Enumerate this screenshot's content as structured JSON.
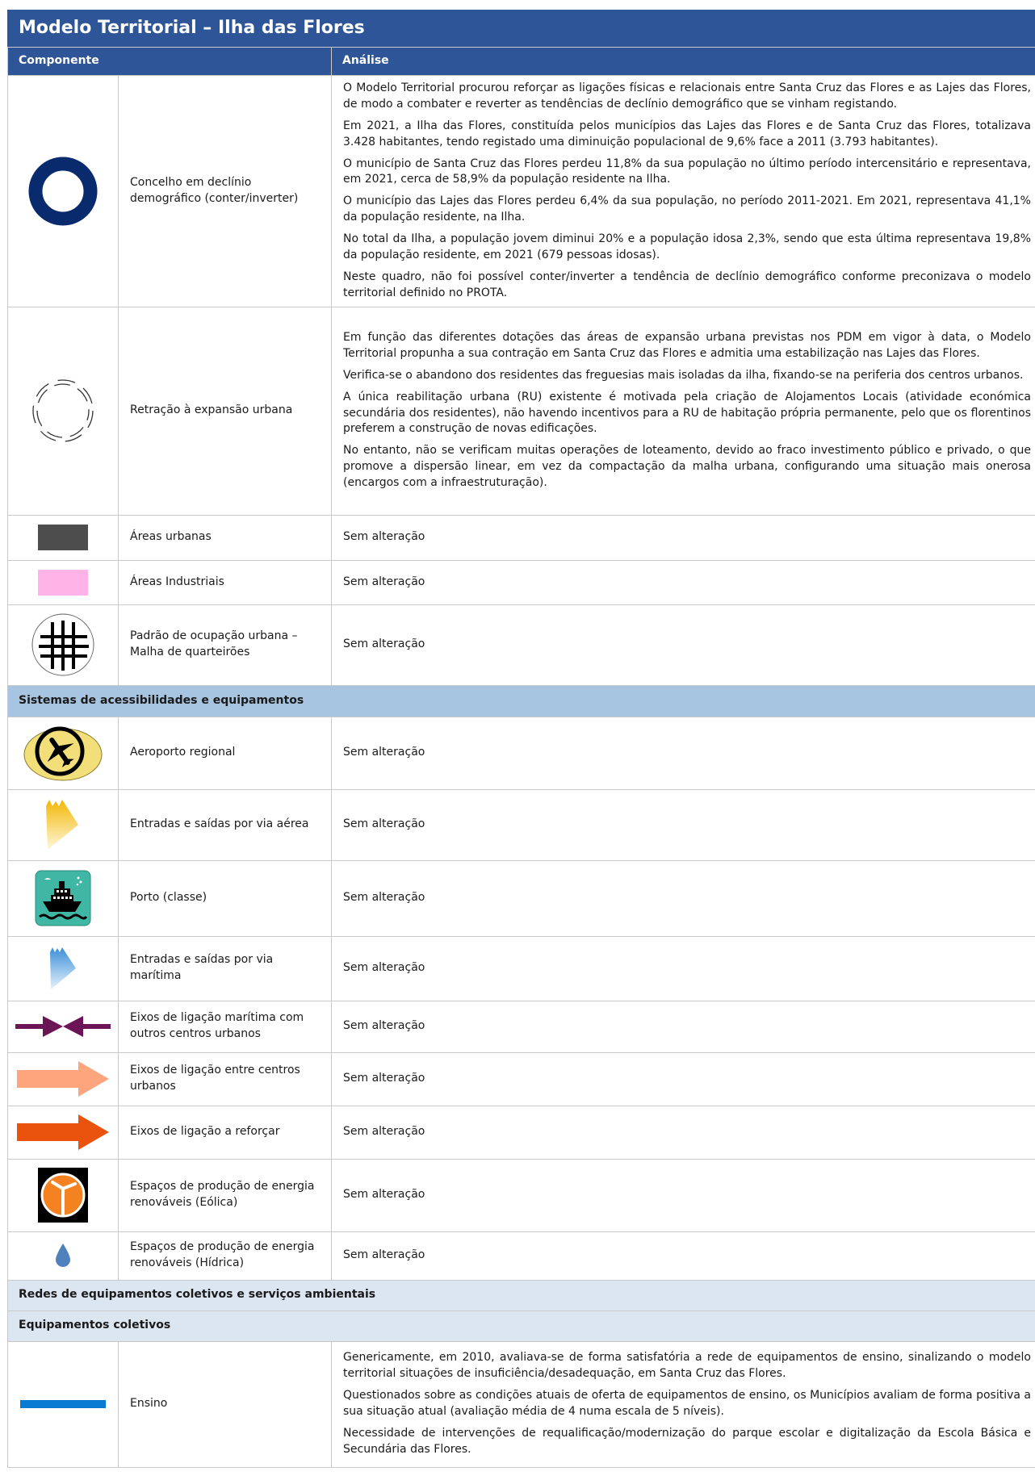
{
  "title": "Modelo Territorial – Ilha das Flores",
  "header": {
    "component": "Componente",
    "analysis": "Análise"
  },
  "rows": {
    "declinio": {
      "label": "Concelho em declínio demográfico (conter/inverter)",
      "paragraphs": [
        "O Modelo Territorial procurou reforçar as ligações físicas e relacionais entre Santa Cruz das Flores e as Lajes das Flores, de modo a combater e reverter as tendências de declínio demográfico que se vinham registando.",
        "Em 2021, a Ilha das Flores, constituída pelos municípios das Lajes das Flores e de Santa Cruz das Flores, totalizava 3.428 habitantes, tendo registado uma diminuição populacional de 9,6% face a 2011 (3.793 habitantes).",
        "O município de Santa Cruz das Flores perdeu 11,8% da sua população no último período intercensitário e representava, em 2021, cerca de 58,9% da população residente na Ilha.",
        "O município das Lajes das Flores perdeu 6,4% da sua população, no período 2011-2021. Em 2021, representava 41,1% da população residente, na Ilha.",
        "No total da Ilha, a população jovem diminui 20% e a população idosa 2,3%, sendo que esta última representava 19,8% da população residente, em 2021 (679 pessoas idosas).",
        "Neste quadro, não foi possível conter/inverter a tendência de declínio demográfico conforme preconizava o modelo territorial definido no PROTA."
      ]
    },
    "retracao": {
      "label": "Retração à expansão urbana",
      "paragraphs": [
        "Em função das diferentes dotações das áreas de expansão urbana previstas nos PDM em vigor à data, o Modelo Territorial propunha a sua contração em Santa Cruz das Flores e admitia uma estabilização nas Lajes das Flores.",
        "Verifica-se o abandono dos residentes das freguesias mais isoladas da ilha, fixando-se na periferia dos centros urbanos.",
        "A única reabilitação urbana (RU) existente é motivada pela criação de Alojamentos Locais (atividade económica secundária dos residentes), não havendo incentivos para a RU de habitação própria permanente, pelo que os florentinos preferem a construção de novas edificações.",
        "No entanto, não se verificam muitas operações de loteamento, devido ao fraco investimento público e privado, o que promove a dispersão linear, em vez da compactação da malha urbana, configurando uma situação mais onerosa (encargos com a infraestruturação)."
      ]
    },
    "areas_urbanas": {
      "label": "Áreas urbanas",
      "analysis": "Sem alteração"
    },
    "areas_industriais": {
      "label": "Áreas Industriais",
      "analysis": "Sem alteração"
    },
    "padrao": {
      "label": "Padrão de ocupação urbana – Malha de quarteirões",
      "analysis": "Sem alteração"
    },
    "aeroporto": {
      "label": "Aeroporto regional",
      "analysis": "Sem alteração"
    },
    "via_aerea": {
      "label": "Entradas e saídas por via aérea",
      "analysis": "Sem alteração"
    },
    "porto": {
      "label": "Porto (classe)",
      "analysis": "Sem alteração"
    },
    "via_maritima": {
      "label": "Entradas e saídas por via marítima",
      "analysis": "Sem alteração"
    },
    "eixos_maritimos": {
      "label": "Eixos de ligação marítima com outros centros urbanos",
      "analysis": "Sem alteração"
    },
    "eixos_centros": {
      "label": "Eixos de ligação entre centros urbanos",
      "analysis": "Sem alteração"
    },
    "eixos_reforcar": {
      "label": "Eixos de ligação a reforçar",
      "analysis": "Sem alteração"
    },
    "eolica": {
      "label": "Espaços de produção de energia renováveis (Eólica)",
      "analysis": "Sem alteração"
    },
    "hidrica": {
      "label": "Espaços de produção de energia renováveis (Hídrica)",
      "analysis": "Sem alteração"
    },
    "ensino": {
      "label": "Ensino",
      "paragraphs": [
        "Genericamente, em 2010, avaliava-se de forma satisfatória a rede de equipamentos de ensino, sinalizando o modelo territorial situações de insuficiência/desadequação, em Santa Cruz das Flores.",
        "Questionados sobre as condições atuais de oferta de equipamentos de ensino, os Municípios avaliam de forma positiva a sua situação atual (avaliação média de 4 numa escala de 5 níveis).",
        "Necessidade de intervenções de requalificação/modernização do parque escolar e digitalização da Escola Básica e Secundária das Flores."
      ]
    }
  },
  "sections": {
    "acessibilidades": "Sistemas de acessibilidades e equipamentos",
    "redes": "Redes de equipamentos coletivos e serviços ambientais",
    "equipamentos": "Equipamentos coletivos"
  },
  "colors": {
    "header_bg": "#2e5597",
    "section_bg": "#a7c4e0",
    "subsection_bg": "#dce6f1",
    "ring": "#0a2a6e",
    "urban_area": "#4d4d4d",
    "industrial_area": "#ffb3e6",
    "maritime_axis": "#6b1557",
    "axis_light": "#ffa57e",
    "axis_strong": "#e9530d",
    "water_drop": "#4f81bd",
    "education_line": "#0a7bd2"
  },
  "icons": {
    "declinio": "ring-icon",
    "retracao": "dashed-circle-icon",
    "areas_urbanas": "dark-gray-rectangle-icon",
    "areas_industriais": "pink-rectangle-icon",
    "padrao": "block-grid-icon",
    "aeroporto": "airplane-icon",
    "via_aerea": "yellow-chevron-icon",
    "porto": "ship-icon",
    "via_maritima": "blue-chevron-icon",
    "eixos_maritimos": "converging-arrows-icon",
    "eixos_centros": "light-orange-arrow-icon",
    "eixos_reforcar": "orange-arrow-icon",
    "eolica": "wind-turbine-icon",
    "hidrica": "water-drop-icon",
    "ensino": "blue-line-icon"
  }
}
